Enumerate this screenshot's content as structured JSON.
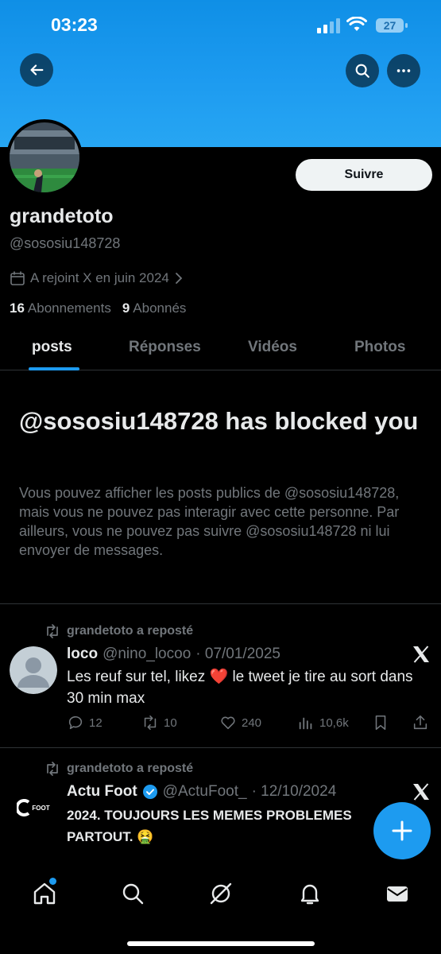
{
  "status_bar": {
    "time": "03:23",
    "battery": "27"
  },
  "profile": {
    "follow_label": "Suivre",
    "display_name": "grandetoto",
    "handle": "@sososiu148728",
    "joined": "A rejoint X en juin 2024",
    "following_count": "16",
    "following_label": "Abonnements",
    "followers_count": "9",
    "followers_label": "Abonnés"
  },
  "tabs": [
    "posts",
    "Réponses",
    "Vidéos",
    "Photos"
  ],
  "blocked": {
    "title": "@sososiu148728 has blocked you",
    "text": "Vous pouvez afficher les posts publics de @sososiu148728, mais vous ne pouvez pas interagir avec cette personne. Par ailleurs, vous ne pouvez pas suivre @sososiu148728 ni lui envoyer de messages."
  },
  "tweets": [
    {
      "repost_label": "grandetoto a reposté",
      "name": "loco",
      "handle": "@nino_locoo",
      "date": "· 07/01/2025",
      "text": "Les reuf sur tel, likez ❤️ le tweet je tire au sort dans 30 min max",
      "replies": "12",
      "retweets": "10",
      "likes": "240",
      "views": "10,6k"
    },
    {
      "repost_label": "grandetoto a reposté",
      "name": "Actu Foot",
      "handle": "@ActuFoot_",
      "date": "· 12/10/2024",
      "avatar_text": "FOOT",
      "text": "2024. TOUJOURS LES MEMES PROBLEMES PARTOUT. 🤮"
    }
  ],
  "colors": {
    "accent": "#1d9bf0",
    "background": "#000000",
    "muted": "#71767b",
    "text": "#e7e9ea"
  }
}
